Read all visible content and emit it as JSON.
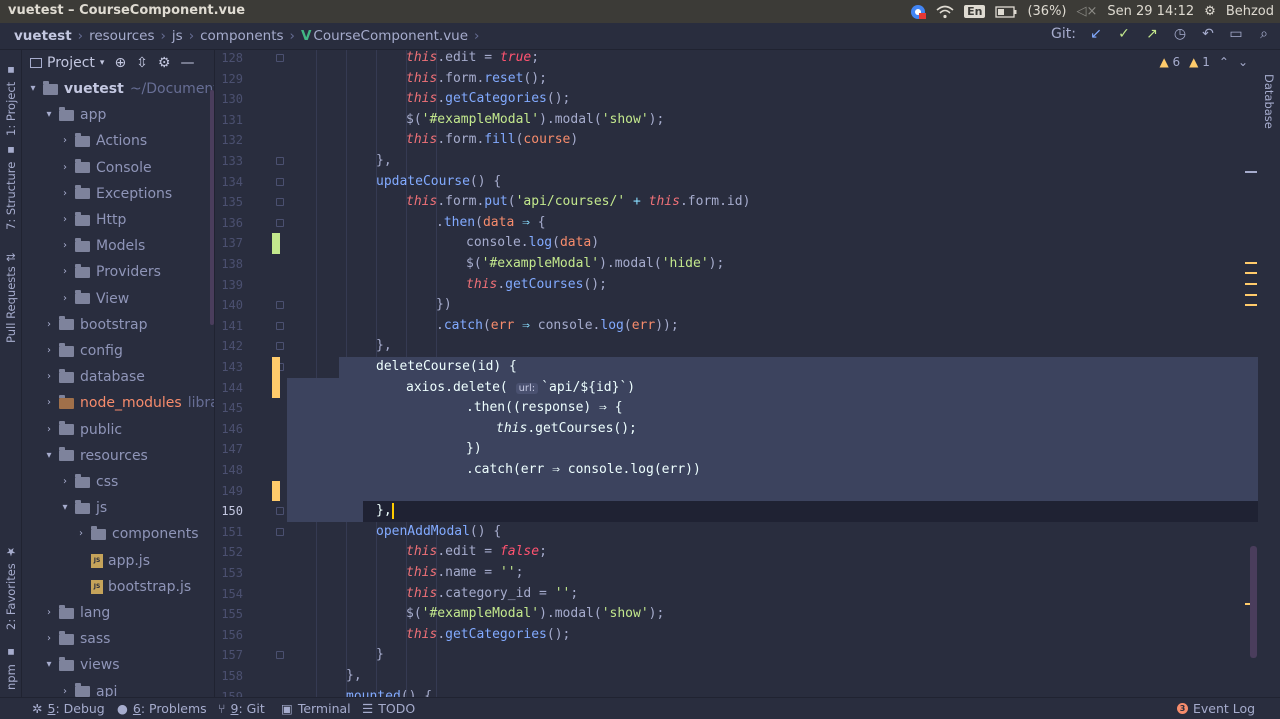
{
  "system_bar": {
    "window_title": "vuetest – CourseComponent.vue",
    "keyboard_layout": "En",
    "battery": "(36%)",
    "datetime": "Sen 29 14:12",
    "user": "Behzod"
  },
  "breadcrumbs": [
    "vuetest",
    "resources",
    "js",
    "components",
    "CourseComponent.vue"
  ],
  "vcs": {
    "label": "Git:"
  },
  "side_tabs": {
    "left": [
      "1: Project",
      "7: Structure",
      "Pull Requests",
      "2: Favorites",
      "npm"
    ],
    "right": [
      "Database"
    ]
  },
  "project_panel": {
    "title": "Project",
    "tree": [
      {
        "label": "vuetest",
        "sub": "~/Documents/...",
        "depth": 0,
        "type": "folder",
        "open": true,
        "bold": true
      },
      {
        "label": "app",
        "depth": 1,
        "type": "folder",
        "open": true
      },
      {
        "label": "Actions",
        "depth": 2,
        "type": "folder",
        "open": false
      },
      {
        "label": "Console",
        "depth": 2,
        "type": "folder",
        "open": false
      },
      {
        "label": "Exceptions",
        "depth": 2,
        "type": "folder",
        "open": false
      },
      {
        "label": "Http",
        "depth": 2,
        "type": "folder",
        "open": false
      },
      {
        "label": "Models",
        "depth": 2,
        "type": "folder",
        "open": false
      },
      {
        "label": "Providers",
        "depth": 2,
        "type": "folder",
        "open": false
      },
      {
        "label": "View",
        "depth": 2,
        "type": "folder",
        "open": false
      },
      {
        "label": "bootstrap",
        "depth": 1,
        "type": "folder",
        "open": false
      },
      {
        "label": "config",
        "depth": 1,
        "type": "folder",
        "open": false
      },
      {
        "label": "database",
        "depth": 1,
        "type": "folder",
        "open": false
      },
      {
        "label": "node_modules",
        "sub": "library",
        "depth": 1,
        "type": "folder",
        "open": false,
        "excluded": true
      },
      {
        "label": "public",
        "depth": 1,
        "type": "folder",
        "open": false
      },
      {
        "label": "resources",
        "depth": 1,
        "type": "folder",
        "open": true
      },
      {
        "label": "css",
        "depth": 2,
        "type": "folder",
        "open": false
      },
      {
        "label": "js",
        "depth": 2,
        "type": "folder",
        "open": true
      },
      {
        "label": "components",
        "depth": 3,
        "type": "folder",
        "open": false
      },
      {
        "label": "app.js",
        "depth": 3,
        "type": "file"
      },
      {
        "label": "bootstrap.js",
        "depth": 3,
        "type": "file"
      },
      {
        "label": "lang",
        "depth": 1,
        "type": "folder",
        "open": false
      },
      {
        "label": "sass",
        "depth": 1,
        "type": "folder",
        "open": false
      },
      {
        "label": "views",
        "depth": 1,
        "type": "folder",
        "open": true
      },
      {
        "label": "api",
        "depth": 2,
        "type": "folder",
        "open": false
      }
    ]
  },
  "inspections": {
    "warnings": "6",
    "weak_warnings": "1"
  },
  "editor": {
    "current_line": "150",
    "lines": [
      {
        "n": "128",
        "indent": 3,
        "tokens": [
          [
            "kw",
            "this"
          ],
          [
            "pl",
            ".edit "
          ],
          [
            "pl",
            "= "
          ],
          [
            "bool",
            "true"
          ],
          [
            "pl",
            ";"
          ]
        ]
      },
      {
        "n": "129",
        "indent": 3,
        "tokens": [
          [
            "kw",
            "this"
          ],
          [
            "pl",
            ".form."
          ],
          [
            "fn",
            "reset"
          ],
          [
            "pl",
            "();"
          ]
        ]
      },
      {
        "n": "130",
        "indent": 3,
        "tokens": [
          [
            "kw",
            "this"
          ],
          [
            "pl",
            "."
          ],
          [
            "fn",
            "getCategories"
          ],
          [
            "pl",
            "();"
          ]
        ]
      },
      {
        "n": "131",
        "indent": 3,
        "tokens": [
          [
            "pl",
            "$("
          ],
          [
            "str",
            "'#exampleModal'"
          ],
          [
            "pl",
            ").modal("
          ],
          [
            "str",
            "'show'"
          ],
          [
            "pl",
            ");"
          ]
        ]
      },
      {
        "n": "132",
        "indent": 3,
        "tokens": [
          [
            "kw",
            "this"
          ],
          [
            "pl",
            ".form."
          ],
          [
            "fn",
            "fill"
          ],
          [
            "pl",
            "("
          ],
          [
            "var",
            "course"
          ],
          [
            "pl",
            ")"
          ]
        ]
      },
      {
        "n": "133",
        "indent": 2,
        "tokens": [
          [
            "pl",
            "},"
          ]
        ]
      },
      {
        "n": "134",
        "indent": 2,
        "tokens": [
          [
            "fn",
            "updateCourse"
          ],
          [
            "pl",
            "() {"
          ]
        ]
      },
      {
        "n": "135",
        "indent": 3,
        "tokens": [
          [
            "kw",
            "this"
          ],
          [
            "pl",
            ".form."
          ],
          [
            "fn",
            "put"
          ],
          [
            "pl",
            "("
          ],
          [
            "str",
            "'api/courses/'"
          ],
          [
            "op",
            " + "
          ],
          [
            "kw",
            "this"
          ],
          [
            "pl",
            ".form.id)"
          ]
        ]
      },
      {
        "n": "136",
        "indent": 4,
        "tokens": [
          [
            "pl",
            "."
          ],
          [
            "fn",
            "then"
          ],
          [
            "pl",
            "("
          ],
          [
            "var",
            "data"
          ],
          [
            "op",
            " ⇒ "
          ],
          [
            "pl",
            "{"
          ]
        ]
      },
      {
        "n": "137",
        "indent": 5,
        "tokens": [
          [
            "pl",
            "console."
          ],
          [
            "fn",
            "log"
          ],
          [
            "pl",
            "("
          ],
          [
            "var",
            "data"
          ],
          [
            "pl",
            ")"
          ]
        ]
      },
      {
        "n": "138",
        "indent": 5,
        "tokens": [
          [
            "pl",
            "$("
          ],
          [
            "str",
            "'#exampleModal'"
          ],
          [
            "pl",
            ").modal("
          ],
          [
            "str",
            "'hide'"
          ],
          [
            "pl",
            ");"
          ]
        ]
      },
      {
        "n": "139",
        "indent": 5,
        "tokens": [
          [
            "kw",
            "this"
          ],
          [
            "pl",
            "."
          ],
          [
            "fn",
            "getCourses"
          ],
          [
            "pl",
            "();"
          ]
        ]
      },
      {
        "n": "140",
        "indent": 4,
        "tokens": [
          [
            "pl",
            "})"
          ]
        ]
      },
      {
        "n": "141",
        "indent": 4,
        "tokens": [
          [
            "pl",
            "."
          ],
          [
            "fn",
            "catch"
          ],
          [
            "pl",
            "("
          ],
          [
            "var",
            "err"
          ],
          [
            "op",
            " ⇒ "
          ],
          [
            "pl",
            "console."
          ],
          [
            "fn",
            "log"
          ],
          [
            "pl",
            "("
          ],
          [
            "var",
            "err"
          ],
          [
            "pl",
            "));"
          ]
        ]
      },
      {
        "n": "142",
        "indent": 2,
        "tokens": [
          [
            "pl",
            "},"
          ]
        ]
      },
      {
        "n": "143",
        "indent": 2,
        "sel": "partial",
        "tokens": [
          [
            "sel",
            "deleteCourse(id) {"
          ]
        ]
      },
      {
        "n": "144",
        "indent": 3,
        "sel": "full",
        "tokens": [
          [
            "sel",
            "axios.delete( "
          ],
          [
            "hint",
            "url:"
          ],
          [
            "sel",
            "`api/${id}`)"
          ]
        ]
      },
      {
        "n": "145",
        "indent": 5,
        "sel": "full",
        "tokens": [
          [
            "sel",
            ".then((response) ⇒ {"
          ]
        ]
      },
      {
        "n": "146",
        "indent": 6,
        "sel": "full",
        "tokens": [
          [
            "selkw",
            "this"
          ],
          [
            "sel",
            ".getCourses();"
          ]
        ]
      },
      {
        "n": "147",
        "indent": 5,
        "sel": "full",
        "tokens": [
          [
            "sel",
            "})"
          ]
        ]
      },
      {
        "n": "148",
        "indent": 5,
        "sel": "full",
        "tokens": [
          [
            "sel",
            ".catch(err ⇒ console.log(err))"
          ]
        ]
      },
      {
        "n": "149",
        "indent": 0,
        "sel": "full",
        "tokens": []
      },
      {
        "n": "150",
        "indent": 2,
        "sel": "caret",
        "tokens": [
          [
            "sel",
            "},"
          ],
          [
            "caret",
            ""
          ]
        ]
      },
      {
        "n": "151",
        "indent": 2,
        "tokens": [
          [
            "fn",
            "openAddModal"
          ],
          [
            "pl",
            "() {"
          ]
        ]
      },
      {
        "n": "152",
        "indent": 3,
        "tokens": [
          [
            "kw",
            "this"
          ],
          [
            "pl",
            ".edit "
          ],
          [
            "pl",
            "= "
          ],
          [
            "bool",
            "false"
          ],
          [
            "pl",
            ";"
          ]
        ]
      },
      {
        "n": "153",
        "indent": 3,
        "tokens": [
          [
            "kw",
            "this"
          ],
          [
            "pl",
            ".name = "
          ],
          [
            "str",
            "''"
          ],
          [
            "pl",
            ";"
          ]
        ]
      },
      {
        "n": "154",
        "indent": 3,
        "tokens": [
          [
            "kw",
            "this"
          ],
          [
            "pl",
            ".category_id = "
          ],
          [
            "str",
            "''"
          ],
          [
            "pl",
            ";"
          ]
        ]
      },
      {
        "n": "155",
        "indent": 3,
        "tokens": [
          [
            "pl",
            "$("
          ],
          [
            "str",
            "'#exampleModal'"
          ],
          [
            "pl",
            ").modal("
          ],
          [
            "str",
            "'show'"
          ],
          [
            "pl",
            ");"
          ]
        ]
      },
      {
        "n": "156",
        "indent": 3,
        "tokens": [
          [
            "kw",
            "this"
          ],
          [
            "pl",
            "."
          ],
          [
            "fn",
            "getCategories"
          ],
          [
            "pl",
            "();"
          ]
        ]
      },
      {
        "n": "157",
        "indent": 2,
        "tokens": [
          [
            "pl",
            "}"
          ]
        ]
      },
      {
        "n": "158",
        "indent": 1,
        "tokens": [
          [
            "pl",
            "},"
          ]
        ]
      },
      {
        "n": "159",
        "indent": 1,
        "tokens": [
          [
            "fn",
            "mounted"
          ],
          [
            "pl",
            "() {"
          ]
        ]
      }
    ]
  },
  "bottom_tabs": [
    {
      "key": "5",
      "label": ": Debug"
    },
    {
      "key": "6",
      "label": ": Problems"
    },
    {
      "key": "9",
      "label": ": Git"
    },
    {
      "key": "",
      "label": "Terminal"
    },
    {
      "key": "",
      "label": "TODO"
    }
  ],
  "event_log": {
    "count": "3",
    "label": "Event Log"
  },
  "colors": {
    "background": "#292d3e",
    "selection": "#3c435e",
    "keyword": "#f07178",
    "function": "#82aaff",
    "string": "#c3e88d",
    "warning": "#ffcb6b"
  }
}
